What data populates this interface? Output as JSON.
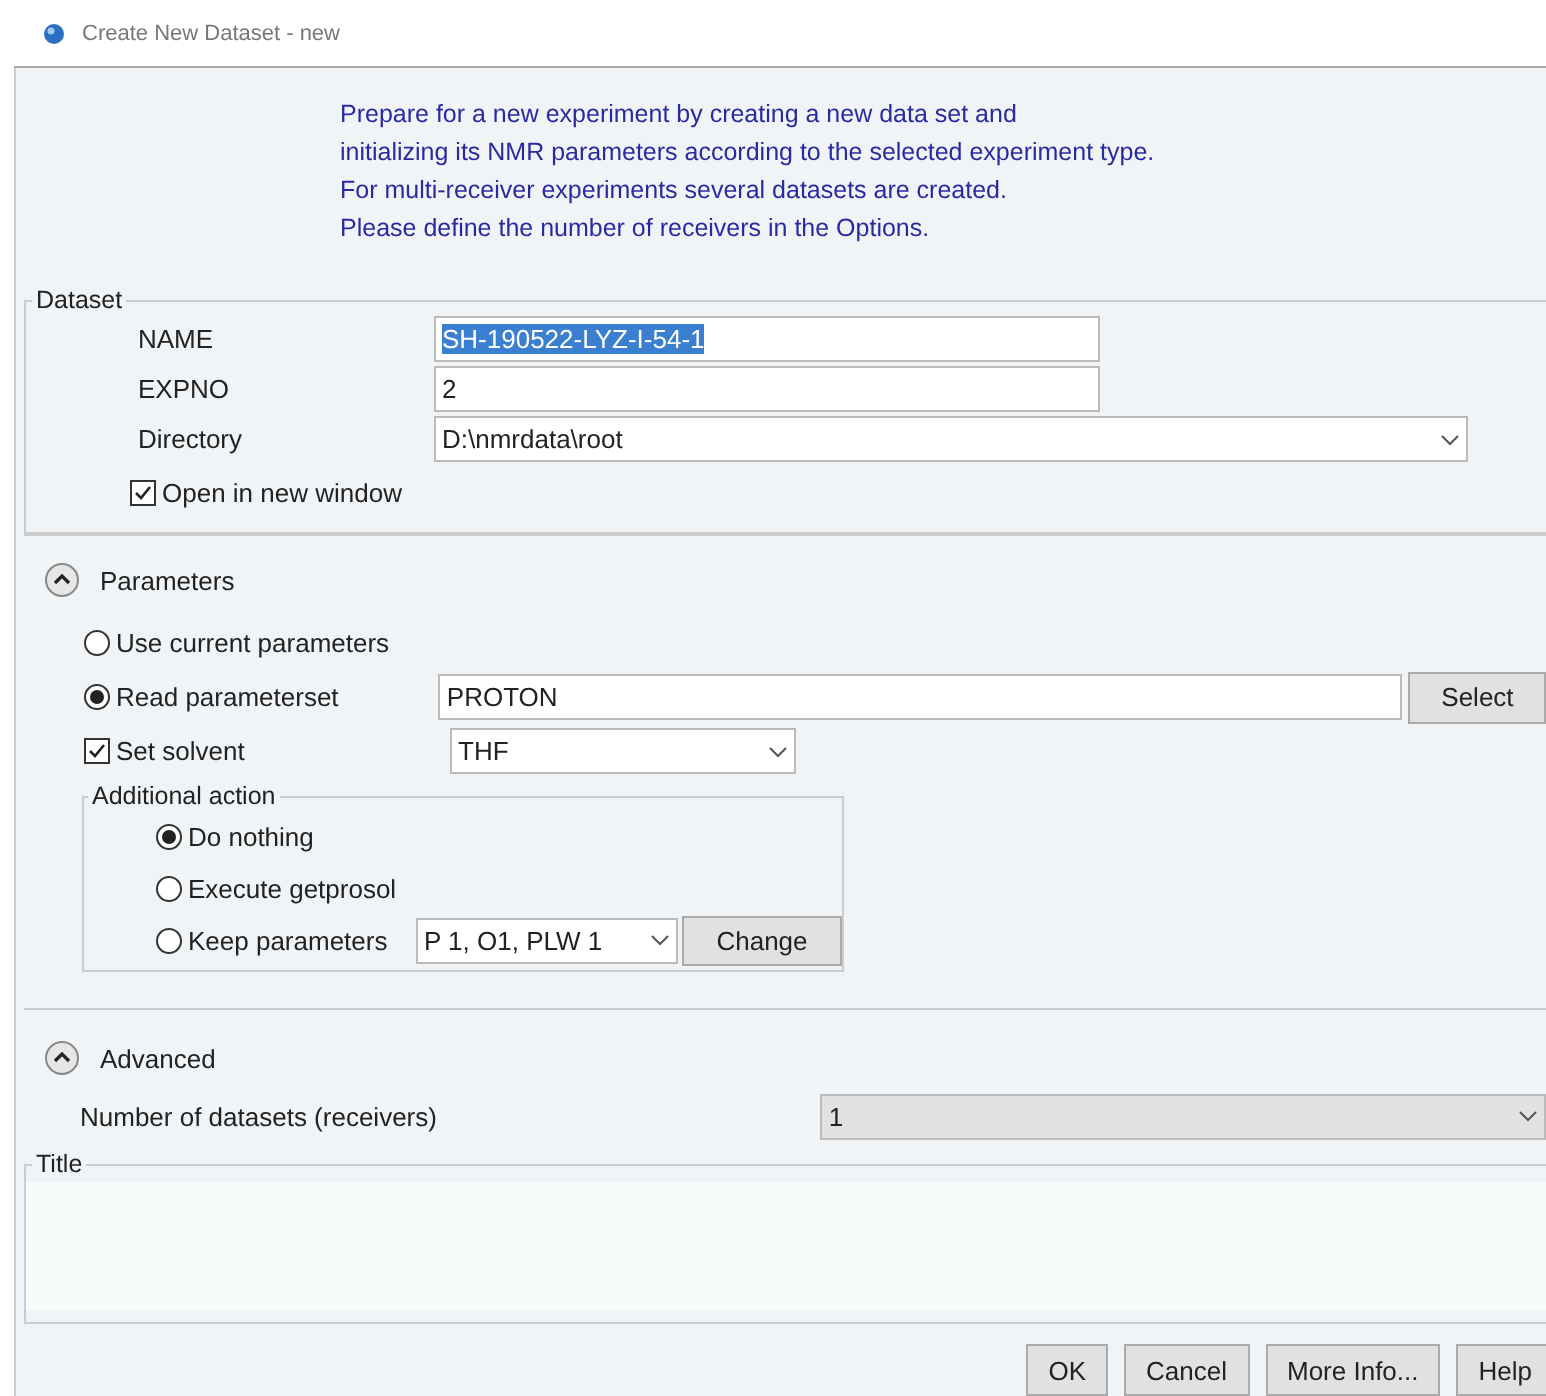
{
  "window": {
    "title": "Create New Dataset - new"
  },
  "intro": [
    "Prepare for a new experiment by creating a new data set and",
    "initializing its NMR parameters according to the selected experiment type.",
    "For multi-receiver experiments several datasets are created.",
    "Please define the number of receivers in the Options."
  ],
  "dataset": {
    "legend": "Dataset",
    "fields": [
      {
        "label": "NAME",
        "value": "SH-190522-LYZ-I-54-1",
        "kind": "text",
        "highlighted": true
      },
      {
        "label": "EXPNO",
        "value": "2",
        "kind": "text",
        "highlighted": false
      },
      {
        "label": "Directory",
        "value": "D:\\nmrdata\\root",
        "kind": "select",
        "highlighted": false
      }
    ],
    "open_new_window": {
      "label": "Open in new window",
      "checked": true
    }
  },
  "parameters": {
    "title": "Parameters",
    "expanded": true,
    "options": [
      {
        "label": "Use current parameters",
        "selected": false
      },
      {
        "label": "Read parameterset",
        "selected": true,
        "value": "PROTON",
        "button": "Select"
      }
    ],
    "solvent": {
      "label": "Set solvent",
      "checked": true,
      "value": "THF"
    },
    "additional_action": {
      "legend": "Additional action",
      "options": [
        {
          "label": "Do nothing",
          "selected": true
        },
        {
          "label": "Execute getprosol",
          "selected": false
        },
        {
          "label": "Keep parameters",
          "selected": false,
          "value": "P 1, O1, PLW 1",
          "button": "Change"
        }
      ]
    }
  },
  "advanced": {
    "title": "Advanced",
    "expanded": true,
    "label": "Number of datasets (receivers)",
    "value": "1"
  },
  "title_box": {
    "legend": "Title"
  },
  "buttons": [
    "OK",
    "Cancel",
    "More Info...",
    "Help"
  ]
}
